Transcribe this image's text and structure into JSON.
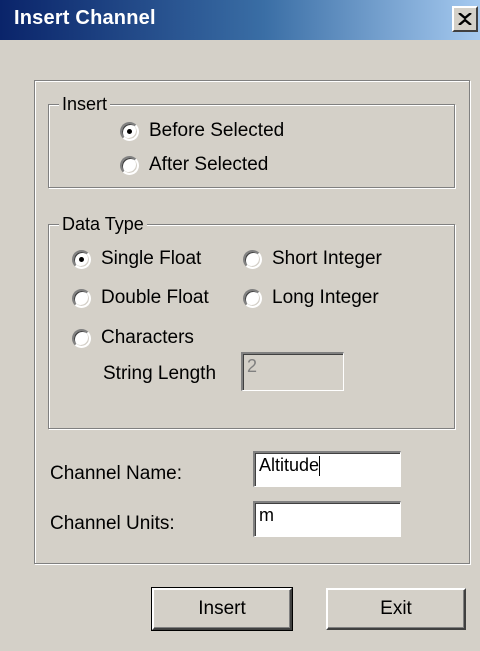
{
  "window": {
    "title": "Insert Channel"
  },
  "insert_group": {
    "title": "Insert",
    "options": [
      {
        "label": "Before Selected",
        "checked": true
      },
      {
        "label": "After Selected",
        "checked": false
      }
    ]
  },
  "data_type_group": {
    "title": "Data Type",
    "options": [
      {
        "label": "Single Float",
        "checked": true
      },
      {
        "label": "Short Integer",
        "checked": false
      },
      {
        "label": "Double Float",
        "checked": false
      },
      {
        "label": "Long Integer",
        "checked": false
      },
      {
        "label": "Characters",
        "checked": false
      }
    ],
    "string_length_label": "String Length",
    "string_length_value": "2"
  },
  "channel_name": {
    "label": "Channel Name:",
    "value": "Altitude"
  },
  "channel_units": {
    "label": "Channel Units:",
    "value": "m"
  },
  "buttons": {
    "insert": "Insert",
    "exit": "Exit"
  }
}
